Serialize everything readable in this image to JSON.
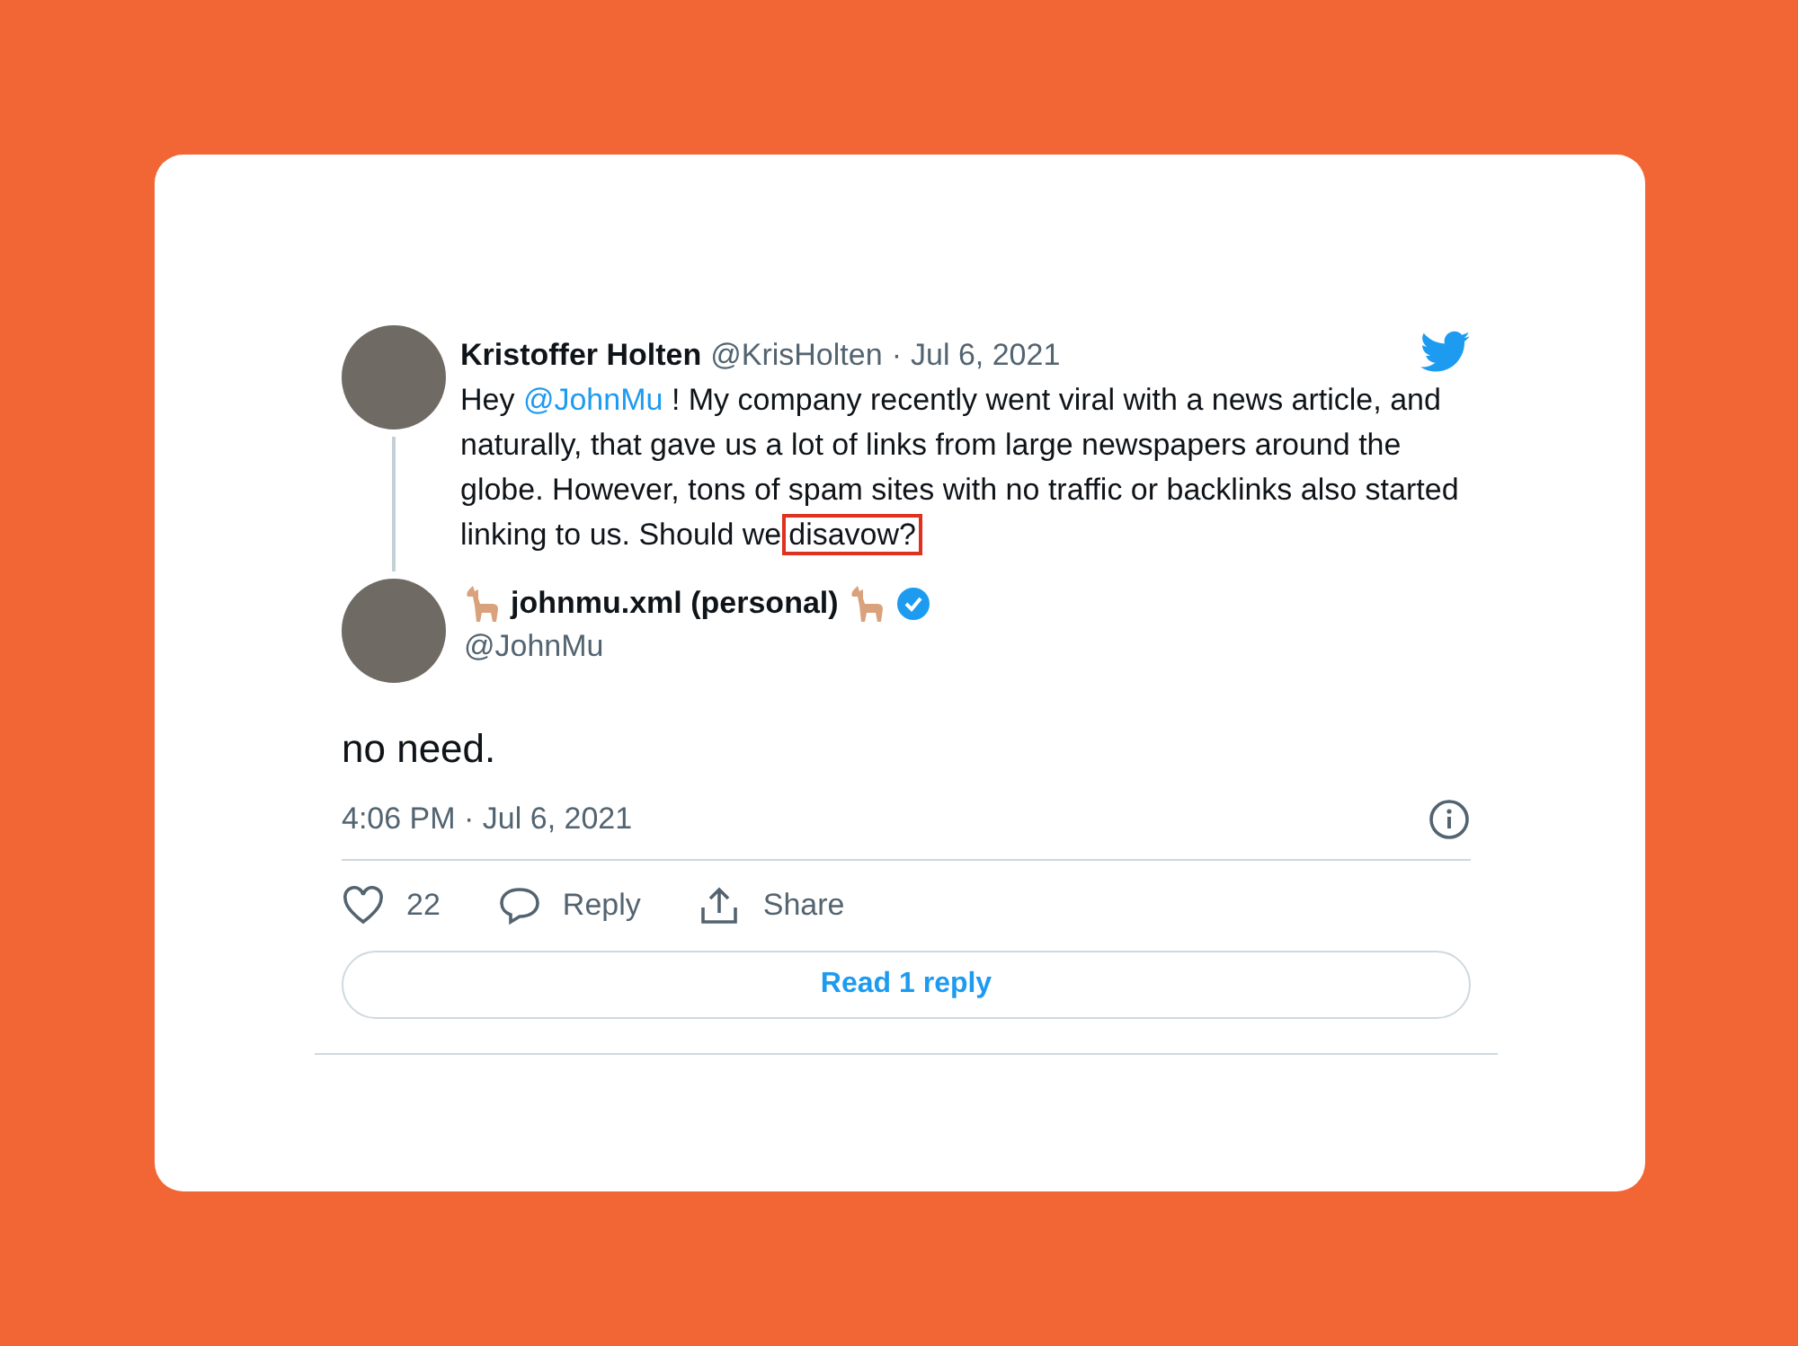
{
  "parent_tweet": {
    "name": "Kristoffer Holten",
    "handle": "@KrisHolten",
    "separator": "·",
    "date": "Jul 6, 2021",
    "body": [
      {
        "kind": "text",
        "text": "Hey "
      },
      {
        "kind": "mention",
        "text": "@JohnMu"
      },
      {
        "kind": "text",
        "text": " ! My company recently went viral with a news article, and naturally, that gave us a lot of links from large newspapers around the globe. However, tons of spam sites with no traffic or backlinks also started linking to us. Should we"
      },
      {
        "kind": "highlight",
        "text": "disavow?"
      }
    ]
  },
  "reply_tweet": {
    "name": "johnmu.xml (personal)",
    "verified": true,
    "handle": "@JohnMu",
    "text": "no need.",
    "timestamp": "4:06 PM · Jul 6, 2021"
  },
  "actions": [
    {
      "kind": "like",
      "label": "22"
    },
    {
      "kind": "reply",
      "label": "Reply"
    },
    {
      "kind": "share",
      "label": "Share"
    }
  ],
  "read_replies_button": "Read 1 reply"
}
